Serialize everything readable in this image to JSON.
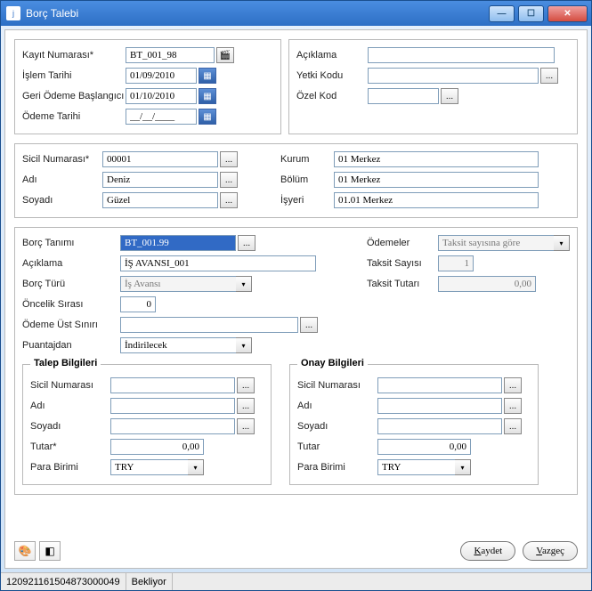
{
  "window": {
    "title": "Borç Talebi"
  },
  "winbtns": {
    "min": "—",
    "max": "☐",
    "close": "✕"
  },
  "top": {
    "kayit_no_lbl": "Kayıt Numarası*",
    "kayit_no": "BT_001_98",
    "islem_tarihi_lbl": "İşlem Tarihi",
    "islem_tarihi": "01/09/2010",
    "geri_odeme_lbl": "Geri Ödeme Başlangıcı",
    "geri_odeme": "01/10/2010",
    "odeme_tarihi_lbl": "Ödeme Tarihi",
    "odeme_tarihi": "__/__/____",
    "aciklama_lbl": "Açıklama",
    "aciklama": "",
    "yetki_lbl": "Yetki Kodu",
    "yetki": "",
    "ozel_lbl": "Özel Kod",
    "ozel": ""
  },
  "sicil": {
    "sicil_lbl": "Sicil Numarası*",
    "sicil": "00001",
    "adi_lbl": "Adı",
    "adi": "Deniz",
    "soyadi_lbl": "Soyadı",
    "soyadi": "Güzel",
    "kurum_lbl": "Kurum",
    "kurum": "01 Merkez",
    "bolum_lbl": "Bölüm",
    "bolum": "01 Merkez",
    "isyeri_lbl": "İşyeri",
    "isyeri": "01.01 Merkez"
  },
  "borc": {
    "tanim_lbl": "Borç Tanımı",
    "tanim": "BT_001.99",
    "aciklama_lbl": "Açıklama",
    "aciklama": "İŞ AVANSI_001",
    "tur_lbl": "Borç Türü",
    "tur": "İş Avansı",
    "oncelik_lbl": "Öncelik Sırası",
    "oncelik": "0",
    "ust_lbl": "Ödeme Üst Sınırı",
    "ust": "",
    "puantaj_lbl": "Puantajdan",
    "puantaj": "İndirilecek",
    "odemeler_lbl": "Ödemeler",
    "odemeler": "Taksit sayısına göre",
    "taksit_sayi_lbl": "Taksit Sayısı",
    "taksit_sayi": "1",
    "taksit_tutar_lbl": "Taksit Tutarı",
    "taksit_tutar": "0,00"
  },
  "talep": {
    "legend": "Talep Bilgileri",
    "sicil_lbl": "Sicil Numarası",
    "sicil": "",
    "adi_lbl": "Adı",
    "adi": "",
    "soyadi_lbl": "Soyadı",
    "soyadi": "",
    "tutar_lbl": "Tutar*",
    "tutar": "0,00",
    "para_lbl": "Para Birimi",
    "para": "TRY"
  },
  "onay": {
    "legend": "Onay Bilgileri",
    "sicil_lbl": "Sicil Numarası",
    "sicil": "",
    "adi_lbl": "Adı",
    "adi": "",
    "soyadi_lbl": "Soyadı",
    "soyadi": "",
    "tutar_lbl": "Tutar",
    "tutar": "0,00",
    "para_lbl": "Para Birimi",
    "para": "TRY"
  },
  "buttons": {
    "kaydet": "Kaydet",
    "vazgec": "Vazgeç"
  },
  "iconbtns": {
    "colors": "🎨",
    "eraser": "◧"
  },
  "pick": "...",
  "status": {
    "id": "120921161504873000049",
    "state": "Bekliyor"
  }
}
